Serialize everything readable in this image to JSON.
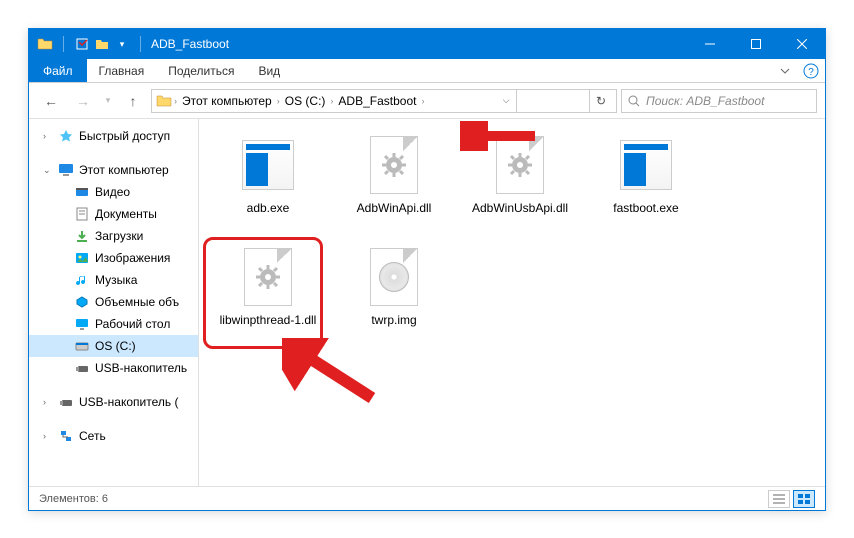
{
  "window": {
    "title": "ADB_Fastboot"
  },
  "ribbon": {
    "file": "Файл",
    "tabs": [
      "Главная",
      "Поделиться",
      "Вид"
    ]
  },
  "breadcrumb": {
    "items": [
      "Этот компьютер",
      "OS (C:)",
      "ADB_Fastboot"
    ]
  },
  "search": {
    "placeholder": "Поиск: ADB_Fastboot"
  },
  "sidebar": {
    "quick": "Быстрый доступ",
    "thispc": "Этот компьютер",
    "items": [
      {
        "label": "Видео",
        "icon": "video"
      },
      {
        "label": "Документы",
        "icon": "docs"
      },
      {
        "label": "Загрузки",
        "icon": "downloads"
      },
      {
        "label": "Изображения",
        "icon": "pictures"
      },
      {
        "label": "Музыка",
        "icon": "music"
      },
      {
        "label": "Объемные объ",
        "icon": "3d"
      },
      {
        "label": "Рабочий стол",
        "icon": "desktop"
      },
      {
        "label": "OS (C:)",
        "icon": "disk",
        "selected": true
      },
      {
        "label": "USB-накопитель",
        "icon": "usb"
      }
    ],
    "usb_outer": "USB-накопитель (",
    "network": "Сеть"
  },
  "files": [
    {
      "name": "adb.exe",
      "type": "exe"
    },
    {
      "name": "AdbWinApi.dll",
      "type": "dll"
    },
    {
      "name": "AdbWinUsbApi.dll",
      "type": "dll"
    },
    {
      "name": "fastboot.exe",
      "type": "exe"
    },
    {
      "name": "libwinpthread-1.dll",
      "type": "dll"
    },
    {
      "name": "twrp.img",
      "type": "img"
    }
  ],
  "status": {
    "count_label": "Элементов: 6"
  }
}
